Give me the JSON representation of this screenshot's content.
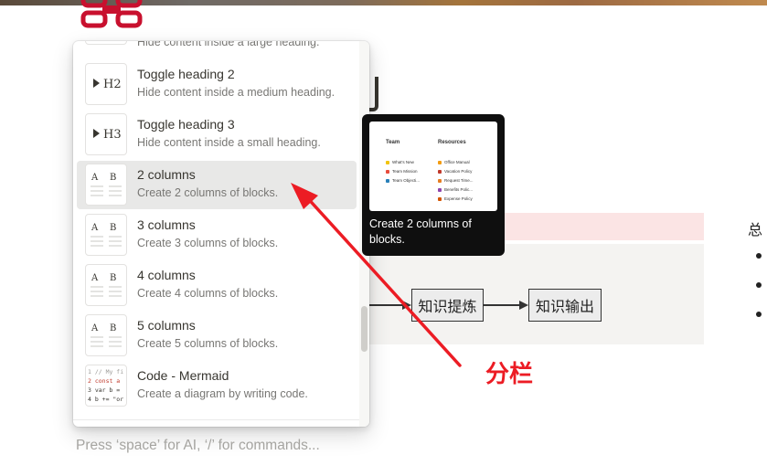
{
  "menu": {
    "cut_item": {
      "desc": "Hide content inside a large heading."
    },
    "items": [
      {
        "icon": "toggle-heading-2-icon",
        "title": "Toggle heading 2",
        "desc": "Hide content inside a medium heading.",
        "thumb": "▶ H2"
      },
      {
        "icon": "toggle-heading-3-icon",
        "title": "Toggle heading 3",
        "desc": "Hide content inside a small heading.",
        "thumb": "▶ H3"
      },
      {
        "icon": "two-columns-icon",
        "title": "2 columns",
        "desc": "Create 2 columns of blocks.",
        "thumb": "A B",
        "active": true
      },
      {
        "icon": "three-columns-icon",
        "title": "3 columns",
        "desc": "Create 3 columns of blocks.",
        "thumb": "A B"
      },
      {
        "icon": "four-columns-icon",
        "title": "4 columns",
        "desc": "Create 4 columns of blocks.",
        "thumb": "A B"
      },
      {
        "icon": "five-columns-icon",
        "title": "5 columns",
        "desc": "Create 5 columns of blocks.",
        "thumb": "A B"
      },
      {
        "icon": "code-mermaid-icon",
        "title": "Code - Mermaid",
        "desc": "Create a diagram by writing code.",
        "code_lines": [
          "1 // My fi",
          "2 const a",
          "3 var b =",
          "4 b += \"or"
        ]
      }
    ]
  },
  "tooltip": {
    "text": "Create 2 columns of blocks.",
    "preview": {
      "left_heading": "Team",
      "left_rows": [
        "What's New",
        "Team Mission",
        "Team Objecti..."
      ],
      "right_heading": "Resources",
      "right_rows": [
        "Office Manual",
        "Vacation Policy",
        "Request Time...",
        "Benefits Polic...",
        "Expense Policy"
      ]
    }
  },
  "page": {
    "placeholder": "Press ‘space’ for AI, ‘/’ for commands...",
    "diagram_nodes": [
      "知识提炼",
      "知识输出"
    ],
    "side_title": "总А"
  },
  "annotation": {
    "label": "分栏",
    "color": "#ec1c24"
  },
  "colors": {
    "menu_active": "#e8e8e7",
    "tooltip_bg": "#0f0f0f",
    "callout_red": "#fbe4e4"
  }
}
